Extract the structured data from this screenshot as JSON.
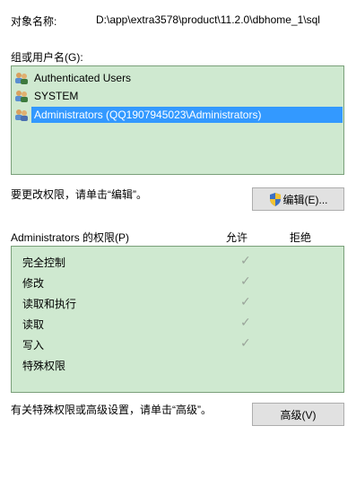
{
  "object": {
    "label": "对象名称:",
    "path": "D:\\app\\extra3578\\product\\11.2.0\\dbhome_1\\sql"
  },
  "groups": {
    "label": "组或用户名(G):",
    "items": [
      {
        "name": "Authenticated Users",
        "selected": false
      },
      {
        "name": "SYSTEM",
        "selected": false
      },
      {
        "name": "Administrators (QQ1907945023\\Administrators)",
        "selected": true
      }
    ]
  },
  "change": {
    "text": "要更改权限，请单击“编辑”。",
    "edit_button": "编辑(E)..."
  },
  "permissions": {
    "header": "Administrators 的权限(P)",
    "allow": "允许",
    "deny": "拒绝",
    "check_glyph": "✓",
    "rows": [
      {
        "name": "完全控制",
        "allow": true,
        "deny": false
      },
      {
        "name": "修改",
        "allow": true,
        "deny": false
      },
      {
        "name": "读取和执行",
        "allow": true,
        "deny": false
      },
      {
        "name": "读取",
        "allow": true,
        "deny": false
      },
      {
        "name": "写入",
        "allow": true,
        "deny": false
      },
      {
        "name": "特殊权限",
        "allow": false,
        "deny": false
      }
    ]
  },
  "advanced": {
    "text": "有关特殊权限或高级设置，请单击“高级”。",
    "button": "高级(V)"
  },
  "colors": {
    "list_bg": "#cfe9d0",
    "selection": "#3399ff"
  }
}
